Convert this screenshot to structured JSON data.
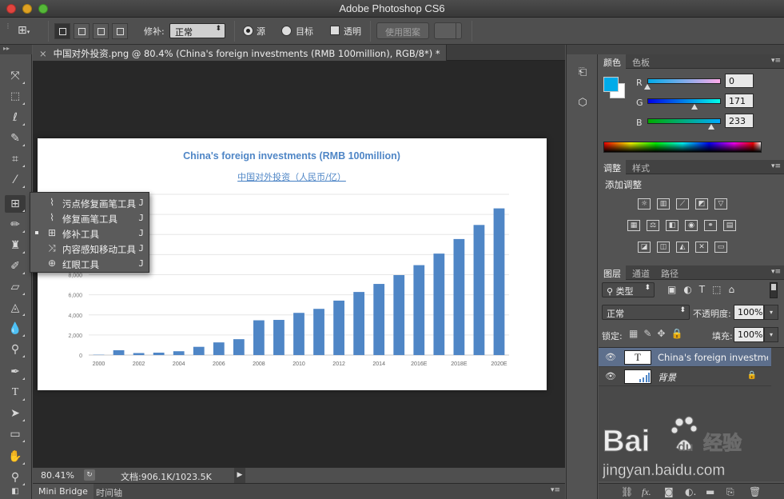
{
  "window": {
    "title": "Adobe Photoshop CS6"
  },
  "options_bar": {
    "patch_label": "修补:",
    "patch_mode": "正常",
    "source_label": "源",
    "destination_label": "目标",
    "transparent_label": "透明",
    "use_pattern_label": "使用图案"
  },
  "document": {
    "tab_title": "中国对外投资.png @ 80.4% (China's foreign investments (RMB 100million), RGB/8*) *",
    "close_glyph": "×"
  },
  "chart_data": {
    "type": "bar",
    "title": "China's foreign investments (RMB 100million)",
    "subtitle": "中国对外投资（人民币/亿）",
    "categories": [
      "2000",
      "2001",
      "2002",
      "2003",
      "2004",
      "2005",
      "2006",
      "2007",
      "2008",
      "2009",
      "2010",
      "2011",
      "2012",
      "2013",
      "2014",
      "2015E",
      "2016E",
      "2017E",
      "2018E",
      "2019E",
      "2020E"
    ],
    "x_tick_labels": [
      "2000",
      "2002",
      "2004",
      "2006",
      "2008",
      "2010",
      "2012",
      "2014",
      "2016E",
      "2018E",
      "2020E"
    ],
    "values": [
      30,
      480,
      200,
      240,
      380,
      820,
      1260,
      1580,
      3460,
      3500,
      4200,
      4600,
      5420,
      6280,
      7080,
      7960,
      8950,
      10100,
      11550,
      12950,
      14600
    ],
    "y_tick_labels": [
      "0",
      "2,000",
      "4,000",
      "6,000",
      "8,000"
    ],
    "ylim": [
      0,
      16000
    ],
    "grid": true,
    "bar_color": "#4f86c6"
  },
  "tool_flyout": {
    "items": [
      {
        "label": "污点修复画笔工具",
        "key": "J",
        "selected": false
      },
      {
        "label": "修复画笔工具",
        "key": "J",
        "selected": false
      },
      {
        "label": "修补工具",
        "key": "J",
        "selected": true
      },
      {
        "label": "内容感知移动工具",
        "key": "J",
        "selected": false
      },
      {
        "label": "红眼工具",
        "key": "J",
        "selected": false
      }
    ]
  },
  "status_bar": {
    "zoom": "80.41%",
    "doc_size": "文档:906.1K/1023.5K"
  },
  "bottom_tabs": [
    "Mini Bridge",
    "时间轴"
  ],
  "color_panel": {
    "tabs": [
      "颜色",
      "色板"
    ],
    "foreground": "#00abe9",
    "background": "#ffffff",
    "channels": [
      {
        "name": "R",
        "value": "0",
        "level": 0
      },
      {
        "name": "G",
        "value": "171",
        "level": 0.67
      },
      {
        "name": "B",
        "value": "233",
        "level": 0.91
      }
    ]
  },
  "adjustments_panel": {
    "tabs": [
      "调整",
      "样式"
    ],
    "heading": "添加调整"
  },
  "layers_panel": {
    "tabs": [
      "图层",
      "通道",
      "路径"
    ],
    "filter_kind": "类型",
    "blend_mode": "正常",
    "opacity_label": "不透明度:",
    "opacity_value": "100%",
    "lock_label": "锁定:",
    "fill_label": "填充:",
    "fill_value": "100%",
    "layers": [
      {
        "name": "China's foreign investments (RMB 100million)",
        "type_glyph": "T",
        "selected": true
      },
      {
        "name": "背景",
        "type_glyph": "",
        "selected": false,
        "locked": true
      }
    ]
  },
  "watermark": {
    "brand": "Bai",
    "brand2": "du",
    "cn": "经验",
    "url": "jingyan.baidu.com"
  }
}
